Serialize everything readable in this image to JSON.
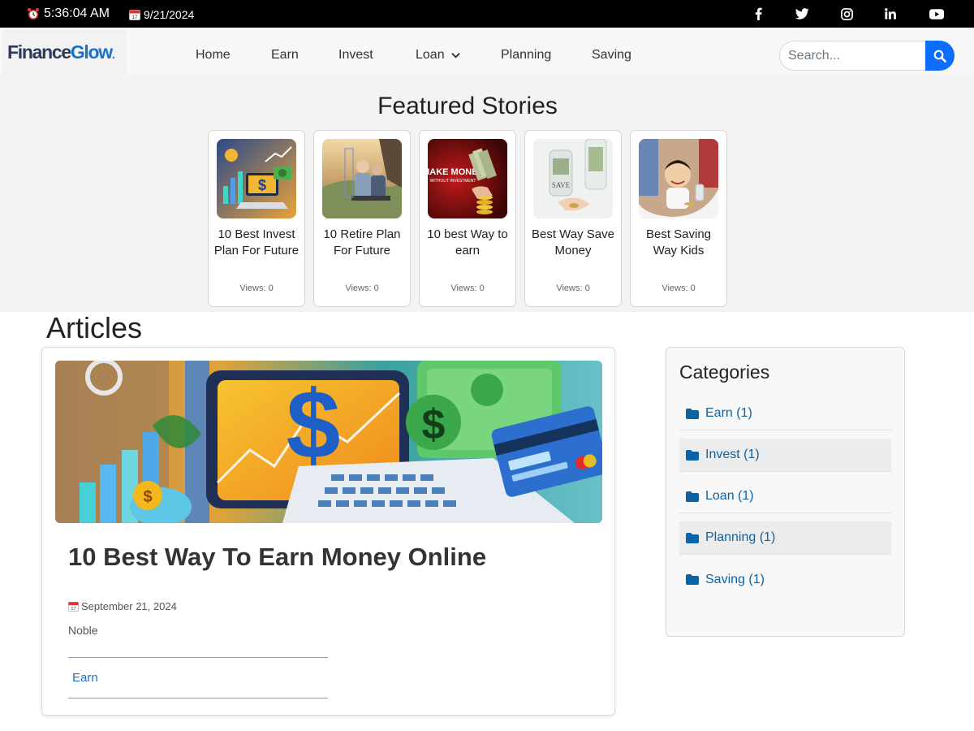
{
  "topbar": {
    "time": "5:36:04 AM",
    "date": "9/21/2024",
    "social": [
      "facebook-icon",
      "twitter-icon",
      "instagram-icon",
      "linkedin-icon",
      "youtube-icon"
    ]
  },
  "brand": {
    "part1": "Finance",
    "part2": "Glow",
    "dot": "."
  },
  "nav": {
    "home": "Home",
    "earn": "Earn",
    "invest": "Invest",
    "loan": "Loan",
    "planning": "Planning",
    "saving": "Saving"
  },
  "search": {
    "placeholder": "Search..."
  },
  "featured": {
    "heading": "Featured Stories",
    "stories": [
      {
        "title": "10 Best Invest Plan For Future",
        "views": "Views: 0"
      },
      {
        "title": "10 Retire Plan For Future",
        "views": "Views: 0"
      },
      {
        "title": "10 best Way to earn",
        "views": "Views: 0",
        "image_text": "MAKE MONEY",
        "image_subtext": "WITHOUT INVESTMENT"
      },
      {
        "title": "Best Way Save Money",
        "views": "Views: 0",
        "image_text": "SAVE"
      },
      {
        "title": "Best Saving Way Kids",
        "views": "Views: 0"
      }
    ]
  },
  "articles": {
    "heading": "Articles",
    "items": [
      {
        "title": "10 Best Way To Earn Money Online",
        "date": "September 21, 2024",
        "author": "Noble",
        "category": "Earn"
      }
    ]
  },
  "sidebar": {
    "title": "Categories",
    "categories": [
      {
        "label": "Earn (1)"
      },
      {
        "label": "Invest (1)"
      },
      {
        "label": "Loan (1)"
      },
      {
        "label": "Planning (1)"
      },
      {
        "label": "Saving (1)"
      }
    ]
  },
  "colors": {
    "topbar": "#000000",
    "accent": "#0d6efd",
    "link": "#1a73c8",
    "category_link": "#0b63a6"
  }
}
